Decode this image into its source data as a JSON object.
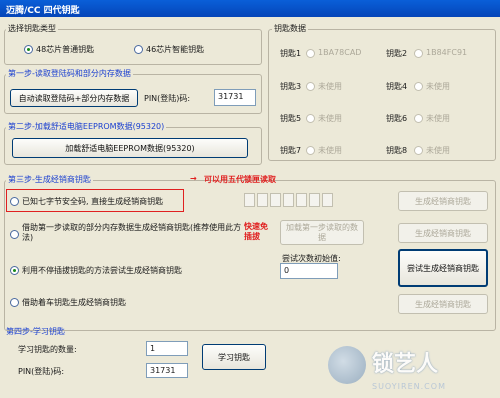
{
  "window": {
    "title": "迈腾/CC 四代钥匙"
  },
  "key_type": {
    "title": "选择钥匙类型",
    "option1": "48芯片普通钥匙",
    "option2": "46芯片智能钥匙",
    "selected": "option1"
  },
  "key_data": {
    "title": "钥匙数据",
    "slots": [
      {
        "label": "钥匙1",
        "value": "1BA78CAD"
      },
      {
        "label": "钥匙2",
        "value": "1B84FC91"
      },
      {
        "label": "钥匙3",
        "value": "未使用"
      },
      {
        "label": "钥匙4",
        "value": "未使用"
      },
      {
        "label": "钥匙5",
        "value": "未使用"
      },
      {
        "label": "钥匙6",
        "value": "未使用"
      },
      {
        "label": "钥匙7",
        "value": "未使用"
      },
      {
        "label": "钥匙8",
        "value": "未使用"
      }
    ]
  },
  "step1": {
    "title": "第一步-读取登陆码和部分内存数据",
    "button": "自动读取登陆码+部分内存数据",
    "pin_label": "PIN(登陆)码:",
    "pin_value": "31731"
  },
  "step2": {
    "title": "第二步-加载舒适电脑EEPROM数据(95320)",
    "button": "加载舒适电脑EEPROM数据(95320)"
  },
  "step3": {
    "title": "第三步-生成经销商钥匙",
    "annotation": "可以用五代锁匣读取",
    "opt1": "已知七字节安全码, 直接生成经销商钥匙",
    "opt2": "借助第一步读取的部分内存数据生成经销商钥匙(推荐使用此方法)",
    "opt3": "利用不停插拔钥匙的方法尝试生成经销商钥匙",
    "opt4": "借助着车钥匙生成经销商钥匙",
    "quick_label": "快速免插拔",
    "gen_button": "生成经销商钥匙",
    "load_button": "加载第一步读取的数据",
    "try_label": "尝试次数初始值:",
    "try_value": "0",
    "try_button": "尝试生成经销商钥匙",
    "selected": "opt3"
  },
  "step4": {
    "title": "第四步-学习钥匙",
    "count_label": "学习钥匙的数量:",
    "count_value": "1",
    "pin_label": "PIN(登陆)码:",
    "pin_value": "31731",
    "button": "学习钥匙"
  },
  "watermark": {
    "text": "锁艺人",
    "sub": "SUOYIREN.COM"
  },
  "colors": {
    "accent_blue": "#1a3fd0",
    "annotation_red": "#e02020",
    "titlebar": "#0a5fd8"
  }
}
